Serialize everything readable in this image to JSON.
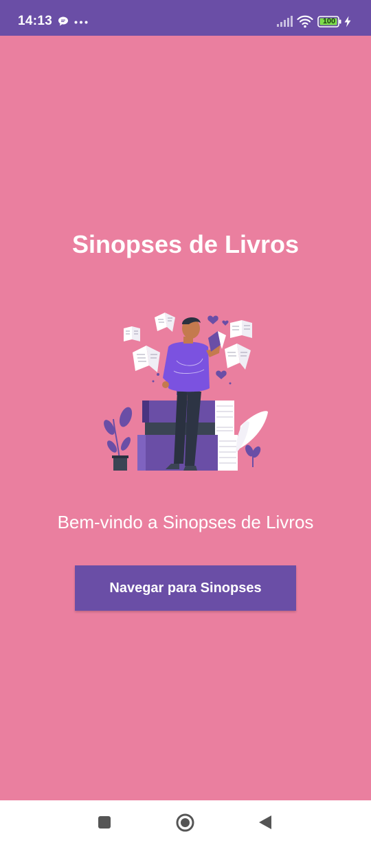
{
  "status_bar": {
    "time": "14:13",
    "battery_level": "100",
    "icons": [
      "chat-bubble-icon",
      "more-dots-icon",
      "signal-icon",
      "wifi-icon",
      "battery-icon",
      "charging-bolt-icon"
    ],
    "background_color": "#6a4ea6"
  },
  "main": {
    "title": "Sinopses de Livros",
    "welcome": "Bem-vindo a Sinopses de Livros",
    "button_label": "Navegar para Sinopses",
    "background_color": "#ea7f9f",
    "button_color": "#6a4ea6",
    "illustration": "person-reading-books-illustration"
  },
  "nav_bar": {
    "icons": [
      "recent-apps-icon",
      "home-icon",
      "back-icon"
    ]
  }
}
